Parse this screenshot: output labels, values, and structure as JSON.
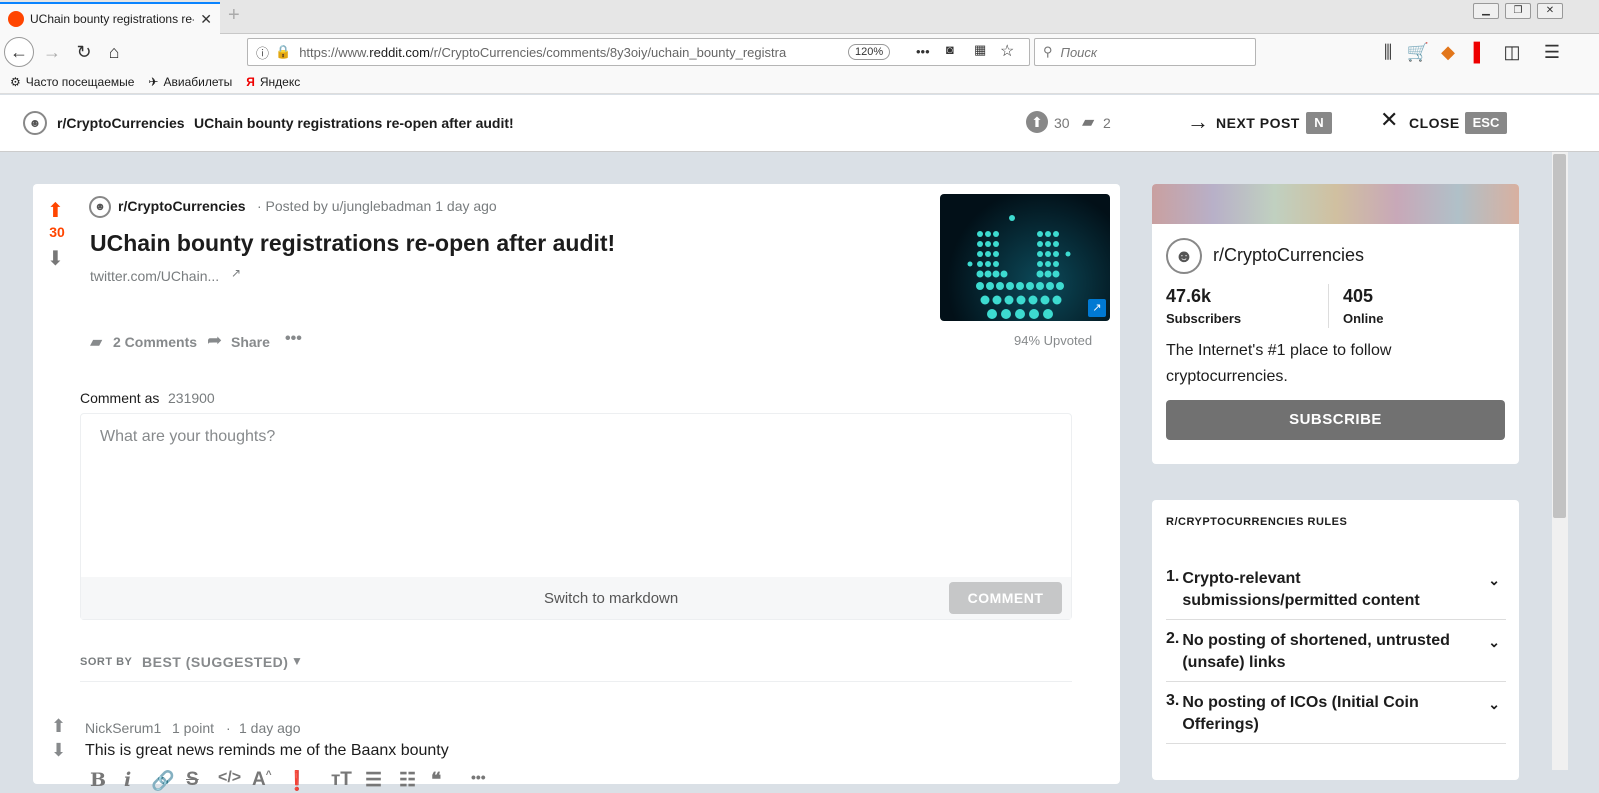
{
  "browser": {
    "tab_title": "UChain bounty registrations re-o",
    "url_prefix": "https://www.",
    "url_domain": "reddit.com",
    "url_path": "/r/CryptoCurrencies/comments/8y3oiy/uchain_bounty_registra",
    "zoom": "120%",
    "search_placeholder": "Поиск",
    "bookmarks": [
      "Часто посещаемые",
      "Авиабилеты",
      "Яндекс"
    ]
  },
  "topbar": {
    "subreddit": "r/CryptoCurrencies",
    "title": "UChain bounty registrations re-open after audit!",
    "upvotes": "30",
    "comments": "2",
    "next_label": "NEXT POST",
    "next_key": "N",
    "close_label": "CLOSE",
    "close_key": "ESC"
  },
  "post": {
    "score": "30",
    "subreddit": "r/CryptoCurrencies",
    "meta": "· Posted by u/junglebadman 1 day ago",
    "title": "UChain bounty registrations re-open after audit!",
    "link": "twitter.com/UChain...",
    "comments_btn": "2 Comments",
    "share_btn": "Share",
    "upvoted": "94% Upvoted",
    "comment_as_label": "Comment as",
    "username": "231900",
    "textarea_placeholder": "What are your thoughts?",
    "switch_markdown": "Switch to markdown",
    "comment_btn": "COMMENT",
    "sort_label": "SORT BY",
    "sort_value": "BEST (SUGGESTED)"
  },
  "comment1": {
    "author": "NickSerum1",
    "points": "1 point",
    "sep": "·",
    "time": "1 day ago",
    "body": "This is great news reminds me of the Baanx bounty"
  },
  "community": {
    "name": "r/CryptoCurrencies",
    "subscribers": "47.6k",
    "subscribers_label": "Subscribers",
    "online": "405",
    "online_label": "Online",
    "description": "The Internet's #1 place to follow cryptocurrencies.",
    "subscribe_btn": "SUBSCRIBE"
  },
  "rules": {
    "heading": "R/CRYPTOCURRENCIES RULES",
    "items": [
      {
        "num": "1.",
        "text": "Crypto-relevant submissions/permitted content"
      },
      {
        "num": "2.",
        "text": "No posting of shortened, untrusted (unsafe) links"
      },
      {
        "num": "3.",
        "text": "No posting of ICOs (Initial Coin Offerings)"
      }
    ]
  },
  "colors": {
    "upvote": "#ff4500",
    "subscribe_bg": "#717171",
    "link_blue": "#0079d3"
  }
}
